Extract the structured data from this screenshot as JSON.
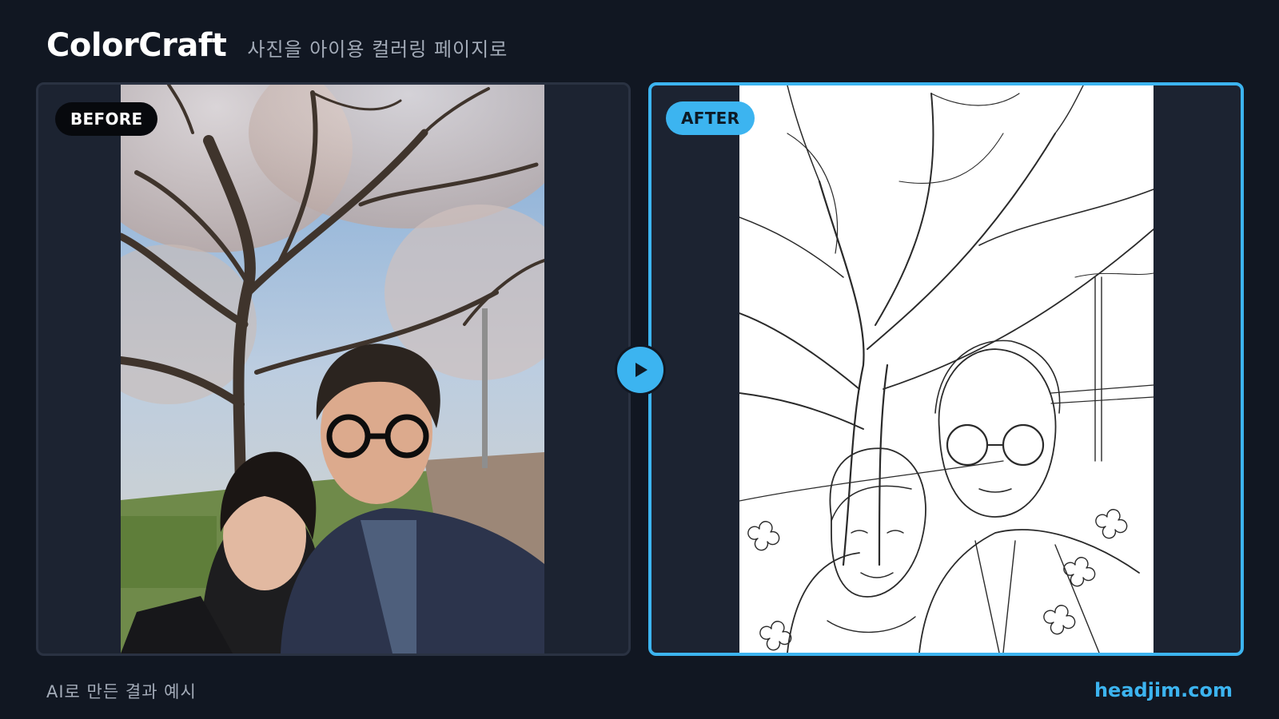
{
  "header": {
    "brand": "ColorCraft",
    "tagline": "사진을 아이용 컬러링 페이지로"
  },
  "panels": {
    "before": {
      "badge": "BEFORE"
    },
    "after": {
      "badge": "AFTER"
    }
  },
  "footer": {
    "caption": "AI로 만든 결과 예시",
    "site": "headjim.com"
  },
  "colors": {
    "background": "#111722",
    "panel": "#1c2331",
    "accent": "#3cb4f0"
  },
  "icons": {
    "play": "play-icon"
  }
}
